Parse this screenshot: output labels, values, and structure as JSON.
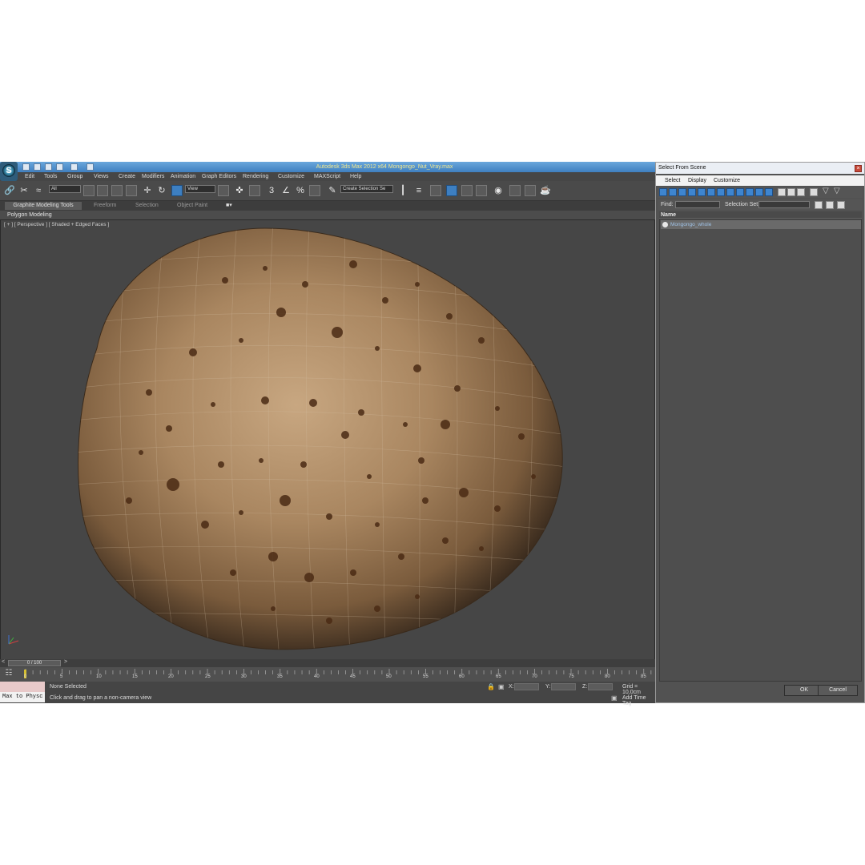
{
  "window": {
    "title": "Autodesk 3ds Max  2012 x64     Mongongo_Nut_Vray.max"
  },
  "menu": [
    "Edit",
    "Tools",
    "Group",
    "Views",
    "Create",
    "Modifiers",
    "Animation",
    "Graph Editors",
    "Rendering",
    "Customize",
    "MAXScript",
    "Help"
  ],
  "toolbar": {
    "selection_filter": "All",
    "reference_coord": "View",
    "named_selection": "Create Selection Se"
  },
  "ribbon": {
    "tabs": [
      "Graphite Modeling Tools",
      "Freeform",
      "Selection",
      "Object Paint"
    ],
    "panel": "Polygon Modeling"
  },
  "viewport": {
    "label": "[ + ] [ Perspective ] [ Shaded + Edged Faces ]"
  },
  "timeline": {
    "slider": "0 / 100",
    "ticks": [
      "0",
      "5",
      "10",
      "15",
      "20",
      "25",
      "30",
      "35",
      "40",
      "45",
      "50",
      "55",
      "60",
      "65",
      "70",
      "75",
      "80",
      "85"
    ]
  },
  "status": {
    "listener": "Max to Physc",
    "selection": "None Selected",
    "prompt": "Click and drag to pan a non-camera view",
    "x_label": "X:",
    "y_label": "Y:",
    "z_label": "Z:",
    "grid": "Grid = 10,0cm",
    "add_time_tag": "Add Time Tag"
  },
  "dialog": {
    "title": "Select From Scene",
    "menu": [
      "Select",
      "Display",
      "Customize"
    ],
    "find_label": "Find:",
    "selection_set_label": "Selection Set:",
    "column_name": "Name",
    "items": [
      "Mongongo_whole"
    ],
    "ok": "OK",
    "cancel": "Cancel"
  },
  "colors": {
    "title_bar": "#4a8bc9",
    "ui_dark": "#444444",
    "nut": "#a07c55"
  }
}
